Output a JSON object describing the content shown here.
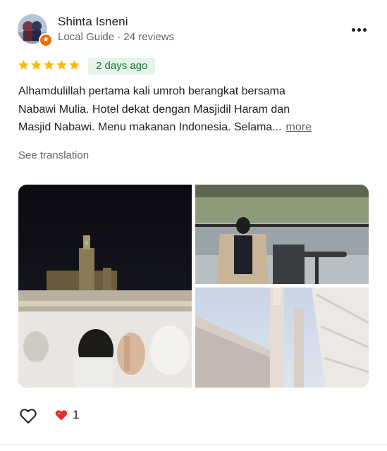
{
  "reviewer": {
    "name": "Shinta Isneni",
    "meta": "Local Guide · 24 reviews",
    "avatar_icon": "avatar",
    "badge_icon": "local-guide-star-icon"
  },
  "rating": {
    "stars": 5,
    "max": 5,
    "color": "#fbbc04"
  },
  "date_label": "2 days ago",
  "review_text": {
    "line1": "Alhamdulillah pertama kali umroh berangkat bersama",
    "line2": "Nabawi Mulia. Hotel dekat dengan Masjidil Haram dan",
    "line3": "Masjid Nabawi. Menu makanan Indonesia. Selama...",
    "more": "more"
  },
  "see_translation": "See translation",
  "photos": [
    "night-clock-tower-crowd",
    "woman-seated-terrace",
    "nabawi-minarets-umbrellas"
  ],
  "actions": {
    "like_icon": "heart-outline-icon",
    "reaction_icon": "red-heart-icon",
    "reaction_count": "1"
  },
  "colors": {
    "chip_bg": "#e6f4ea",
    "chip_text": "#137333",
    "secondary_text": "#5f6368"
  }
}
